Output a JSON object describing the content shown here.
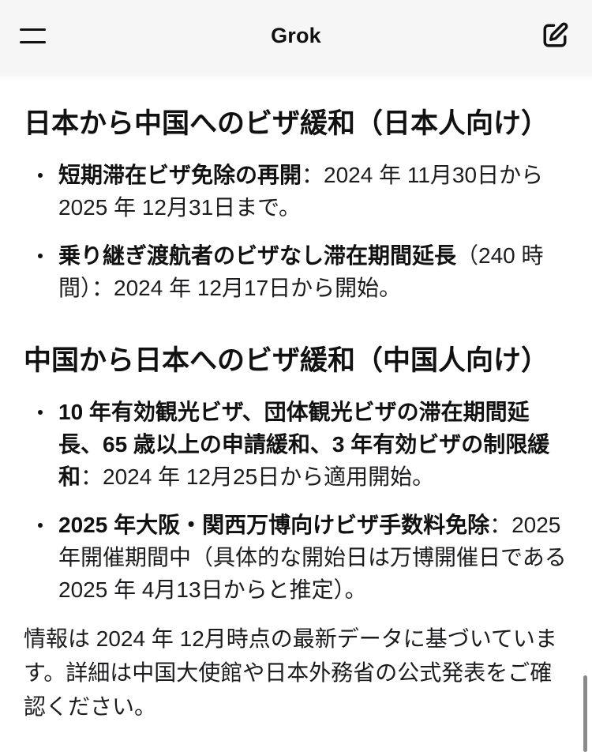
{
  "header": {
    "title": "Grok",
    "menu_icon": "hamburger-menu-icon",
    "compose_icon": "edit-icon"
  },
  "message": {
    "sections": [
      {
        "heading": "日本から中国へのビザ緩和（日本人向け）",
        "items": [
          {
            "label": "短期滞在ビザ免除の再開",
            "detail": "：2024 年 11月30日から 2025 年 12月31日まで。"
          },
          {
            "label": "乗り継ぎ渡航者のビザなし滞在期間延長",
            "detail": "（240 時間）：2024 年 12月17日から開始。"
          }
        ]
      },
      {
        "heading": "中国から日本へのビザ緩和（中国人向け）",
        "items": [
          {
            "label": "10 年有効観光ビザ、団体観光ビザの滞在期間延長、65 歳以上の申請緩和、3 年有効ビザの制限緩和",
            "detail": "：2024 年 12月25日から適用開始。"
          },
          {
            "label": "2025 年大阪・関西万博向けビザ手数料免除",
            "detail": "：2025 年開催期間中（具体的な開始日は万博開催日である 2025 年 4月13日からと推定）。"
          }
        ]
      }
    ],
    "footnote": "情報は 2024 年 12月時点の最新データに基づいています。詳細は中国大使館や日本外務省の公式発表をご確認ください。"
  },
  "scrollbar": {
    "position": 1.0
  },
  "colors": {
    "header_background": "#f6f6f6",
    "page_background": "#ffffff",
    "text": "#111111",
    "text_regular": "#1c1c1e",
    "scrollbar": "#8a8a8a"
  }
}
